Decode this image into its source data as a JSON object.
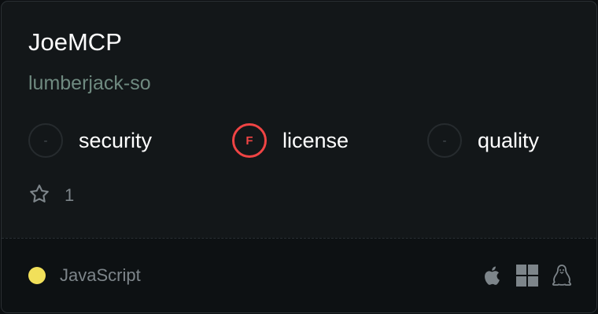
{
  "repo": {
    "name": "JoeMCP",
    "owner": "lumberjack-so"
  },
  "metrics": [
    {
      "grade": "-",
      "label": "security"
    },
    {
      "grade": "F",
      "label": "license"
    },
    {
      "grade": "-",
      "label": "quality"
    }
  ],
  "stars": {
    "icon": "star-outline-icon",
    "count": "1"
  },
  "language": {
    "name": "JavaScript",
    "color": "#f1e05a"
  },
  "platforms": [
    "apple-icon",
    "windows-icon",
    "linux-icon"
  ],
  "colors": {
    "grade_f": "#f04444",
    "subtitle": "#6f8a80"
  }
}
